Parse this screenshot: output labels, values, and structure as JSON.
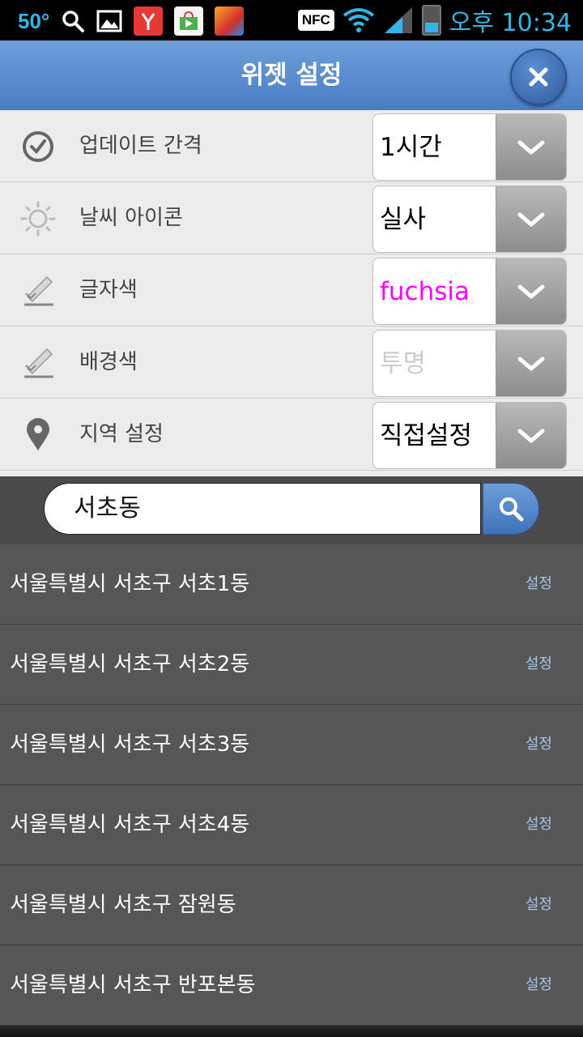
{
  "status_bar": {
    "temperature": "50°",
    "time": "오후 10:34",
    "nfc": "NFC",
    "icons": [
      "search-icon",
      "gallery-icon",
      "app-icon-red",
      "store-icon",
      "game-icon",
      "wifi-icon",
      "signal-icon",
      "battery-icon"
    ]
  },
  "header": {
    "title": "위젯 설정"
  },
  "settings": {
    "rows": [
      {
        "label": "업데이트 간격",
        "value": "1시간",
        "icon": "clock-icon"
      },
      {
        "label": "날씨 아이콘",
        "value": "실사",
        "icon": "sun-icon"
      },
      {
        "label": "글자색",
        "value": "fuchsia",
        "icon": "pencil-icon"
      },
      {
        "label": "배경색",
        "value": "투명",
        "icon": "pencil-icon"
      },
      {
        "label": "지역 설정",
        "value": "직접설정",
        "icon": "location-pin-icon"
      }
    ]
  },
  "search": {
    "value": "서초동"
  },
  "results": [
    {
      "name": "서울특별시 서초구 서초1동",
      "action": "설정"
    },
    {
      "name": "서울특별시 서초구 서초2동",
      "action": "설정"
    },
    {
      "name": "서울특별시 서초구 서초3동",
      "action": "설정"
    },
    {
      "name": "서울특별시 서초구 서초4동",
      "action": "설정"
    },
    {
      "name": "서울특별시 서초구 잠원동",
      "action": "설정"
    },
    {
      "name": "서울특별시 서초구 반포본동",
      "action": "설정"
    }
  ],
  "colors": {
    "accent": "#4a7dc4",
    "status_text": "#33b5e5",
    "text_color_value": "#ff00ff",
    "bg_color_value": "#cccccc"
  }
}
